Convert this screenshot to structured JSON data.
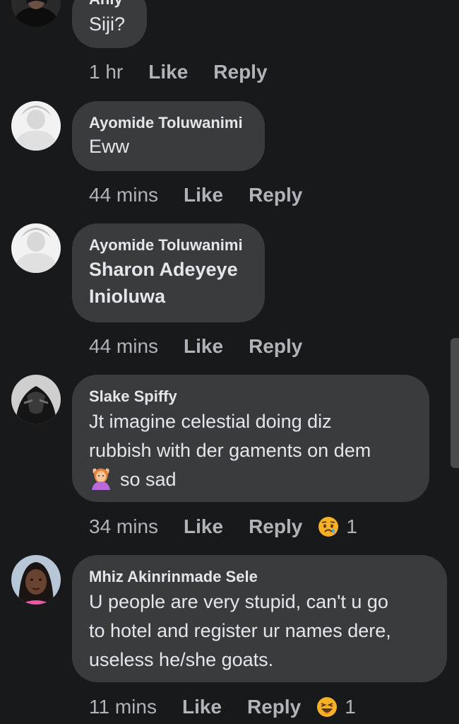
{
  "comments": [
    {
      "author": "Ahly",
      "lines": [
        "Siji?"
      ],
      "time": "1 hr",
      "like": "Like",
      "reply": "Reply",
      "reaction_count": ""
    },
    {
      "author": "Ayomide Toluwanimi",
      "lines": [
        "Eww"
      ],
      "time": "44 mins",
      "like": "Like",
      "reply": "Reply",
      "reaction_count": ""
    },
    {
      "author": "Ayomide Toluwanimi",
      "lines": [
        "Sharon Adeyeye",
        "Inioluwa"
      ],
      "time": "44 mins",
      "like": "Like",
      "reply": "Reply",
      "reaction_count": ""
    },
    {
      "author": "Slake Spiffy",
      "lines": [
        "Jt imagine celestial doing diz",
        "rubbish with der gaments on dem",
        "so sad"
      ],
      "time": "34 mins",
      "like": "Like",
      "reply": "Reply",
      "reaction_icon": "sad-reaction-icon",
      "reaction_count": "1"
    },
    {
      "author": "Mhiz Akinrinmade Sele",
      "lines": [
        "U people are very stupid, can't u go",
        "to hotel and register ur names dere,",
        "useless he/she goats."
      ],
      "time": "11 mins",
      "like": "Like",
      "reply": "Reply",
      "reaction_icon": "haha-reaction-icon",
      "reaction_count": "1"
    }
  ],
  "colors": {
    "background": "#18191a",
    "bubble": "#3a3b3c",
    "primary_text": "#e4e6eb",
    "secondary_text": "#b0b3b8",
    "reaction_yellow": "#f7b125"
  }
}
